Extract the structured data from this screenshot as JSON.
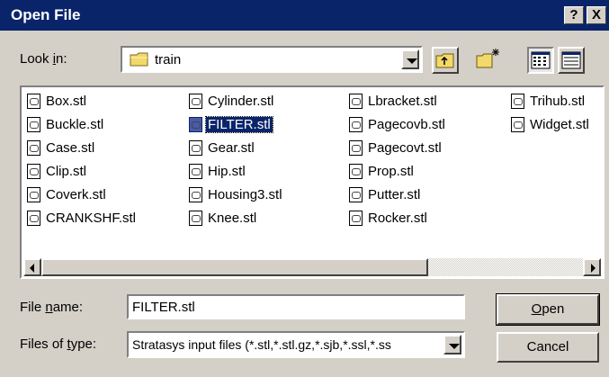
{
  "window": {
    "title": "Open File",
    "help_button": "?",
    "close_button": "X"
  },
  "look_in": {
    "label_pre": "Look ",
    "label_accel": "i",
    "label_post": "n:",
    "value": "train",
    "icon": "folder-icon"
  },
  "toolbar": {
    "up_folder_icon": "up-folder-icon",
    "new_folder_icon": "new-folder-icon",
    "list_view_icon": "list-view-icon",
    "details_view_icon": "details-view-icon"
  },
  "files": {
    "columns": [
      [
        "Box.stl",
        "Buckle.stl",
        "Case.stl",
        "Clip.stl",
        "Coverk.stl",
        "CRANKSHF.stl"
      ],
      [
        "Cylinder.stl",
        "FILTER.stl",
        "Gear.stl",
        "Hip.stl",
        "Housing3.stl",
        "Knee.stl"
      ],
      [
        "Lbracket.stl",
        "Pagecovb.stl",
        "Pagecovt.stl",
        "Prop.stl",
        "Putter.stl",
        "Rocker.stl"
      ],
      [
        "Trihub.stl",
        "Widget.stl"
      ]
    ],
    "selected": "FILTER.stl"
  },
  "file_name": {
    "label_pre": "File ",
    "label_accel": "n",
    "label_post": "ame:",
    "value": "FILTER.stl"
  },
  "file_type": {
    "label_pre": "Files of ",
    "label_accel": "t",
    "label_post": "ype:",
    "value": "Stratasys input files (*.stl,*.stl.gz,*.sjb,*.ssl,*.ss"
  },
  "buttons": {
    "open_accel": "O",
    "open_rest": "pen",
    "cancel": "Cancel"
  },
  "colors": {
    "titlebar": "#0a246a",
    "face": "#d4d0c8",
    "selection": "#0a246a"
  }
}
